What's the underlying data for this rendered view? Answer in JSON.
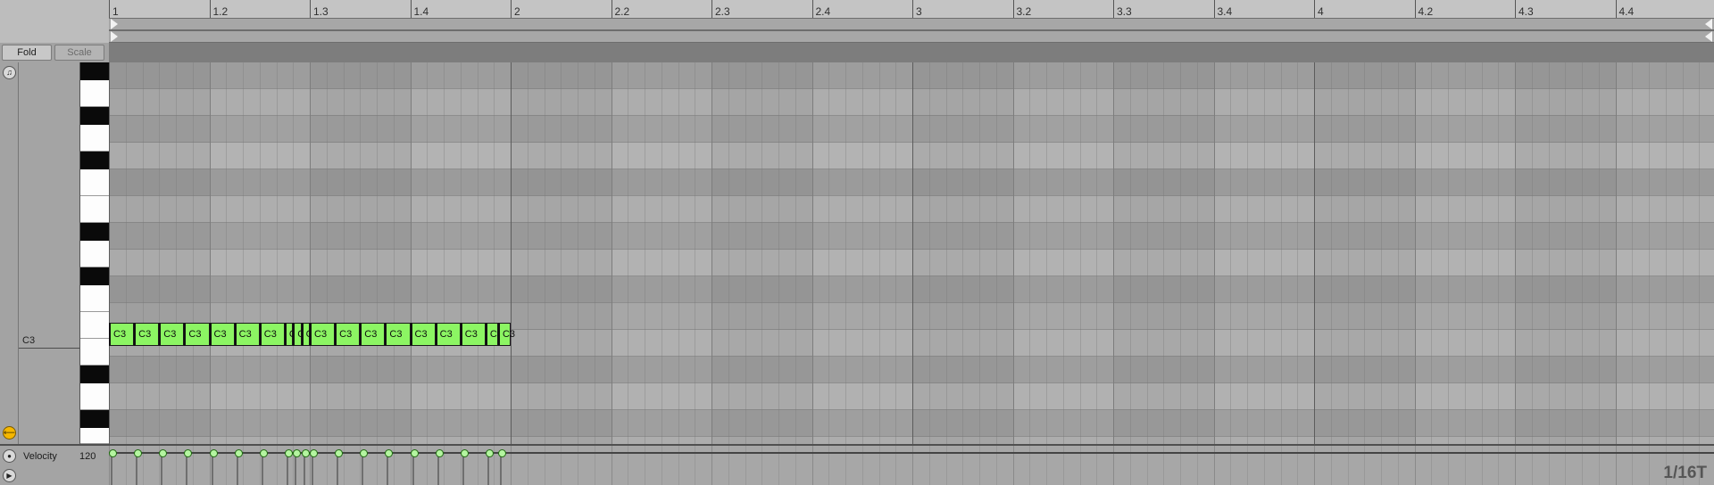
{
  "ruler": {
    "labels": [
      "1",
      "1.2",
      "1.3",
      "1.4",
      "2",
      "2.2",
      "2.3",
      "2.4",
      "3",
      "3.2",
      "3.3",
      "3.4",
      "4",
      "4.2",
      "4.3",
      "4.4"
    ]
  },
  "header": {
    "fold_label": "Fold",
    "scale_label": "Scale"
  },
  "piano": {
    "note_label": "C3"
  },
  "notes": [
    {
      "pitch": "C3",
      "start": 0,
      "length": 0.25
    },
    {
      "pitch": "C3",
      "start": 0.25,
      "length": 0.25
    },
    {
      "pitch": "C3",
      "start": 0.5,
      "length": 0.25
    },
    {
      "pitch": "C3",
      "start": 0.75,
      "length": 0.25
    },
    {
      "pitch": "C3",
      "start": 1.0,
      "length": 0.25
    },
    {
      "pitch": "C3",
      "start": 1.25,
      "length": 0.25
    },
    {
      "pitch": "C3",
      "start": 1.5,
      "length": 0.25
    },
    {
      "pitch": "C3",
      "start": 1.75,
      "length": 0.0833
    },
    {
      "pitch": "C3",
      "start": 1.8333,
      "length": 0.0833
    },
    {
      "pitch": "C3",
      "start": 1.9167,
      "length": 0.0833
    },
    {
      "pitch": "C3",
      "start": 2.0,
      "length": 0.25
    },
    {
      "pitch": "C3",
      "start": 2.25,
      "length": 0.25
    },
    {
      "pitch": "C3",
      "start": 2.5,
      "length": 0.25
    },
    {
      "pitch": "C3",
      "start": 2.75,
      "length": 0.25
    },
    {
      "pitch": "C3",
      "start": 3.0,
      "length": 0.25
    },
    {
      "pitch": "C3",
      "start": 3.25,
      "length": 0.25
    },
    {
      "pitch": "C3",
      "start": 3.5,
      "length": 0.25
    },
    {
      "pitch": "C3",
      "start": 3.75,
      "length": 0.125
    },
    {
      "pitch": "C3",
      "start": 3.875,
      "length": 0.125
    }
  ],
  "velocity": {
    "label": "Velocity",
    "value": "120"
  },
  "grid": {
    "resolution_label": "1/16T"
  },
  "colors": {
    "note": "#8cf563",
    "velocity_dot": "#b4f5a0",
    "preview_button": "#f5b700"
  }
}
